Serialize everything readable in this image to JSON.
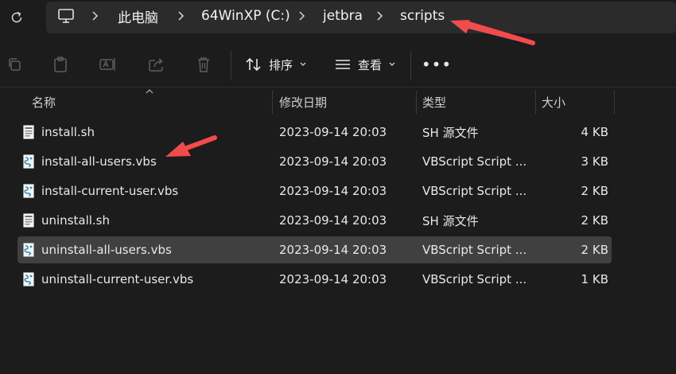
{
  "breadcrumb": {
    "items": [
      "此电脑",
      "64WinXP (C:)",
      "jetbra",
      "scripts"
    ]
  },
  "toolbar": {
    "sort_label": "排序",
    "view_label": "查看",
    "more_label": "•••"
  },
  "columns": {
    "name": "名称",
    "modified": "修改日期",
    "type": "类型",
    "size": "大小"
  },
  "files": [
    {
      "name": "install.sh",
      "modified": "2023-09-14 20:03",
      "type": "SH 源文件",
      "size": "4 KB",
      "icon": "sh-file-icon"
    },
    {
      "name": "install-all-users.vbs",
      "modified": "2023-09-14 20:03",
      "type": "VBScript Script ...",
      "size": "3 KB",
      "icon": "vbs-file-icon"
    },
    {
      "name": "install-current-user.vbs",
      "modified": "2023-09-14 20:03",
      "type": "VBScript Script ...",
      "size": "2 KB",
      "icon": "vbs-file-icon"
    },
    {
      "name": "uninstall.sh",
      "modified": "2023-09-14 20:03",
      "type": "SH 源文件",
      "size": "2 KB",
      "icon": "sh-file-icon"
    },
    {
      "name": "uninstall-all-users.vbs",
      "modified": "2023-09-14 20:03",
      "type": "VBScript Script ...",
      "size": "2 KB",
      "icon": "vbs-file-icon",
      "selected": true
    },
    {
      "name": "uninstall-current-user.vbs",
      "modified": "2023-09-14 20:03",
      "type": "VBScript Script ...",
      "size": "1 KB",
      "icon": "vbs-file-icon"
    }
  ],
  "colors": {
    "background": "#1c1c1c",
    "address_bar": "#2b2b2b",
    "selected_row": "#404040",
    "annotation_arrow": "#f24b4b"
  }
}
